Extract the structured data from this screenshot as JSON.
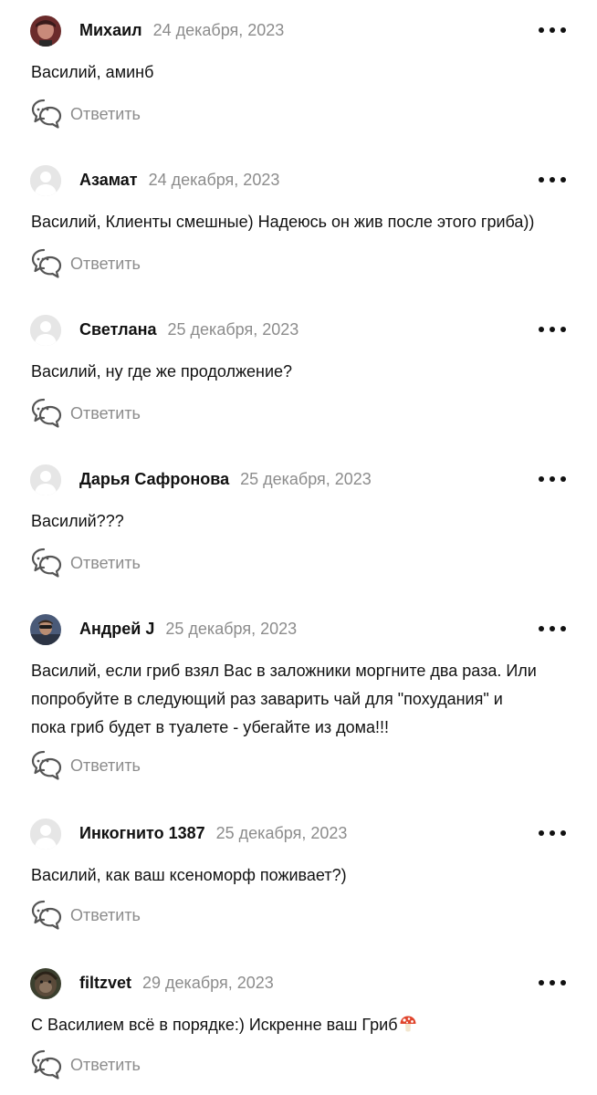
{
  "comments": [
    {
      "avatar": "photo-avatar",
      "author": "Михаил",
      "date": "24 декабря, 2023",
      "lines": [
        "Василий, аминб"
      ],
      "reply_label": "Ответить"
    },
    {
      "avatar": "default-avatar",
      "author": "Азамат",
      "date": "24 декабря, 2023",
      "lines": [
        "Василий, Клиенты смешные) Надеюсь он жив после этого гриба))"
      ],
      "reply_label": "Ответить"
    },
    {
      "avatar": "default-avatar",
      "author": "Светлана",
      "date": "25 декабря, 2023",
      "lines": [
        "Василий, ну где же продолжение?"
      ],
      "reply_label": "Ответить"
    },
    {
      "avatar": "default-avatar",
      "author": "Дарья Сафронова",
      "date": "25 декабря, 2023",
      "lines": [
        "Василий???"
      ],
      "reply_label": "Ответить"
    },
    {
      "avatar": "photo-avatar",
      "author": "Андрей J",
      "date": "25 декабря, 2023",
      "lines": [
        "Василий, если гриб взял Вас в заложники моргните два раза. Или",
        "попробуйте в следующий раз заварить чай для \"похудания\" и",
        "пока гриб будет в туалете - убегайте из дома!!!"
      ],
      "reply_label": "Ответить"
    },
    {
      "avatar": "default-avatar",
      "author": "Инкогнито 1387",
      "date": "25 декабря, 2023",
      "lines": [
        "Василий, как ваш ксеноморф поживает?)"
      ],
      "reply_label": "Ответить"
    },
    {
      "avatar": "photo-avatar",
      "author": "filtzvet",
      "date": "29 декабря, 2023",
      "lines": [
        "С Василием всё в порядке:) Искренне ваш  Гриб"
      ],
      "trailing_emoji": "mushroom-emoji",
      "reply_label": "Ответить"
    }
  ],
  "colors": {
    "text": "#111111",
    "muted": "#8c8c8c",
    "default_avatar": "#e6e6e6",
    "mushroom_cap": "#e0442c"
  },
  "icons": {
    "more": "more-dots-icon",
    "reply": "speech-bubbles-icon"
  }
}
